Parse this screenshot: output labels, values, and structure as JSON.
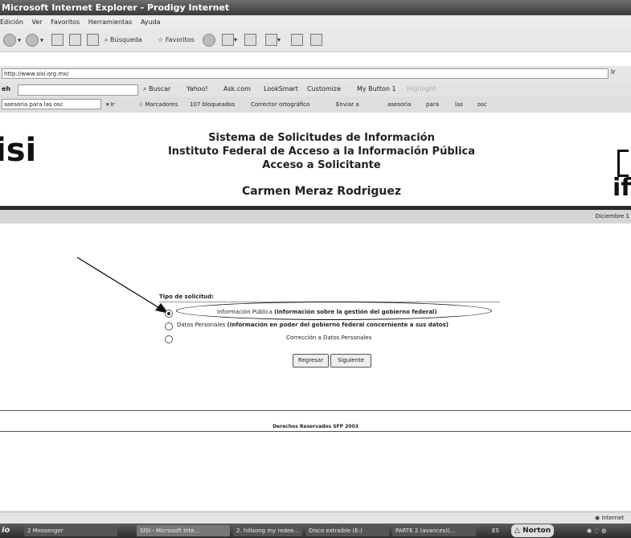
{
  "window": {
    "title": "Microsoft Internet Explorer - Prodigy Internet"
  },
  "menu": [
    "Edición",
    "Ver",
    "Favoritos",
    "Herramientas",
    "Ayuda"
  ],
  "toolbar": {
    "search_label": "Búsqueda",
    "favorites_label": "Favoritos"
  },
  "address": {
    "url": "http://www.sisi.org.mx/",
    "go_label": "Ir"
  },
  "searchbar": {
    "label": "eh",
    "buttons": [
      "Buscar",
      "Yahoo!",
      "Ask.com",
      "LookSmart",
      "Customize",
      "My Button 1",
      "Highlight"
    ]
  },
  "linksbar": {
    "search_value": "asesoria para las osc",
    "items": [
      "Marcadores",
      "107 bloqueados",
      "Corrector ortográfico",
      "Enviar a",
      "asesoria",
      "para",
      "las",
      "osc"
    ]
  },
  "header": {
    "logo_left": "isi",
    "logo_right": "if",
    "line1": "Sistema de Solicitudes de Información",
    "line2": "Instituto Federal de Acceso a la Información Pública",
    "line3": "Acceso a Solicitante",
    "user": "Carmen Meraz Rodriguez",
    "date": "Diciembre 1"
  },
  "form": {
    "heading": "Tipo de solicitud:",
    "options": [
      {
        "label": "Información Pública",
        "detail": "(Información sobre la gestión del gobierno federal)",
        "selected": true
      },
      {
        "label": "Datos Personales",
        "detail": "(Información en poder del gobierno federal concerniente a sus datos)",
        "selected": false
      },
      {
        "label": "Corrección a Datos Personales",
        "detail": "",
        "selected": false
      }
    ],
    "back_button": "Regresar",
    "next_button": "Siguiente"
  },
  "footer": {
    "text": "Derechos Reservados SFP 2003"
  },
  "status": {
    "zone": "Internet"
  },
  "taskbar": {
    "start": "io",
    "tasks": [
      "2 Messenger",
      "SISI - Microsoft Inte...",
      "2. hillsong my redee...",
      "Disco extraíble (E:)",
      "PARTE 2 (avances)(..."
    ],
    "lang": "ES",
    "norton": "Norton"
  }
}
